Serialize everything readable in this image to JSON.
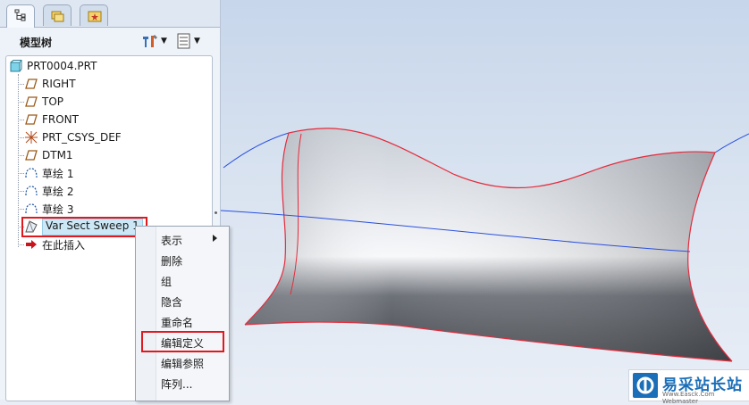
{
  "panel": {
    "title": "模型树",
    "tabs": [
      "model-tree-tab",
      "layers-tab",
      "favorites-tab"
    ]
  },
  "tree": {
    "root": "PRT0004.PRT",
    "items": [
      {
        "label": "RIGHT",
        "icon": "datum-plane-icon"
      },
      {
        "label": "TOP",
        "icon": "datum-plane-icon"
      },
      {
        "label": "FRONT",
        "icon": "datum-plane-icon"
      },
      {
        "label": "PRT_CSYS_DEF",
        "icon": "coordinate-system-icon"
      },
      {
        "label": "DTM1",
        "icon": "datum-plane-icon"
      },
      {
        "label": "草绘 1",
        "icon": "sketch-icon"
      },
      {
        "label": "草绘 2",
        "icon": "sketch-icon"
      },
      {
        "label": "草绘 3",
        "icon": "sketch-icon"
      },
      {
        "label": "Var Sect Sweep 1",
        "icon": "sweep-feature-icon"
      },
      {
        "label": "在此插入",
        "icon": "insert-arrow-icon"
      }
    ]
  },
  "context_menu": {
    "items": [
      "表示",
      "删除",
      "组",
      "隐含",
      "重命名",
      "编辑定义",
      "编辑参照",
      "阵列..."
    ]
  },
  "watermark": {
    "title": "易采站长站",
    "subtitle": "Www.Easck.Com Webmaster"
  },
  "colors": {
    "highlight_box": "#e0191f",
    "selection": "#cce8f6",
    "curve_blue": "#2a4fe0",
    "edge_red": "#e52b3c"
  }
}
